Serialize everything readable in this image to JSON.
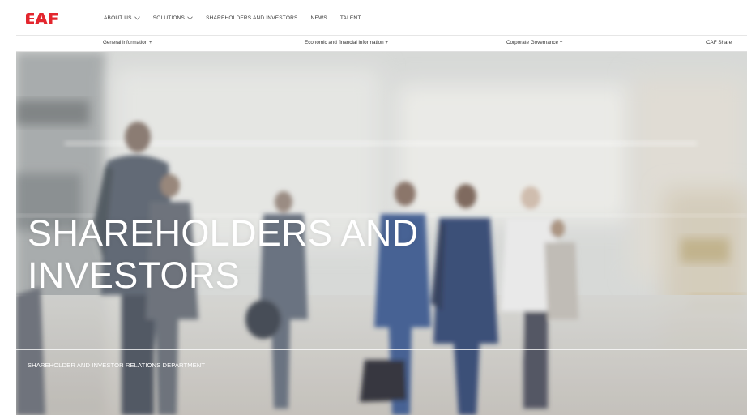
{
  "brand": {
    "logo_text": "CAF",
    "logo_color": "#e3262e"
  },
  "nav": {
    "items": [
      {
        "label": "ABOUT US",
        "has_dropdown": true
      },
      {
        "label": "SOLUTIONS",
        "has_dropdown": true
      },
      {
        "label": "SHAREHOLDERS AND INVESTORS",
        "has_dropdown": false
      },
      {
        "label": "NEWS",
        "has_dropdown": false
      },
      {
        "label": "TALENT",
        "has_dropdown": false
      }
    ],
    "dropdown_icon": "chevron-down-icon"
  },
  "subnav": {
    "items": [
      {
        "label": "General information +"
      },
      {
        "label": "Economic and financial information +"
      },
      {
        "label": "Corporate Governance +"
      },
      {
        "label": "CAF Share"
      }
    ]
  },
  "hero": {
    "title": "SHAREHOLDERS AND INVESTORS",
    "subtitle": "SHAREHOLDER AND INVESTOR RELATIONS DEPARTMENT",
    "image": "blurred-business-people-walking"
  }
}
